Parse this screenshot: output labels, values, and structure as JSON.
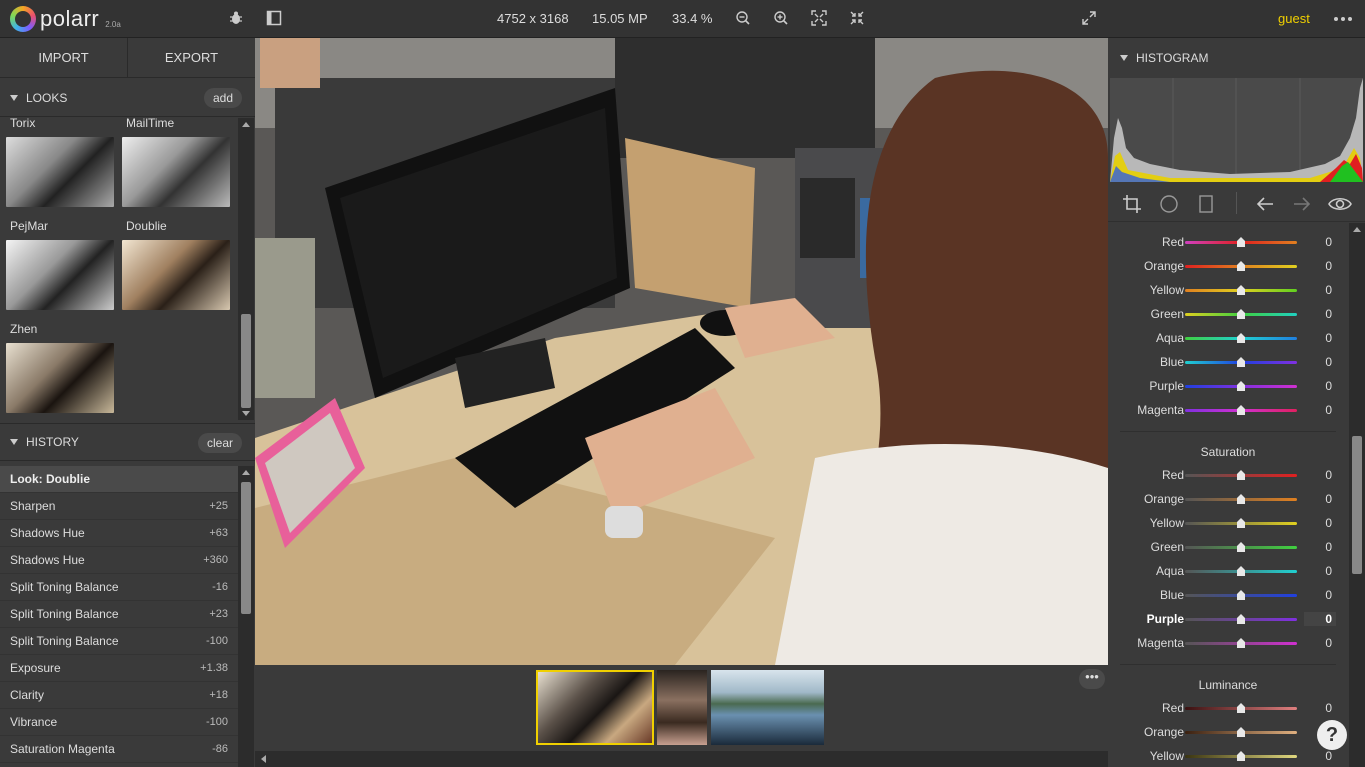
{
  "app": {
    "name": "polarr",
    "version": "2.0a"
  },
  "topbar": {
    "dimensions": "4752 x 3168",
    "megapixels": "15.05 MP",
    "zoom": "33.4 %",
    "user": "guest",
    "icons": [
      "bug-icon",
      "sidebar-toggle-icon",
      "zoom-out-icon",
      "zoom-in-icon",
      "fit-screen-icon",
      "actual-size-icon",
      "fullscreen-icon",
      "more-icon"
    ]
  },
  "left": {
    "import_label": "IMPORT",
    "export_label": "EXPORT",
    "looks": {
      "title": "LOOKS",
      "add_label": "add",
      "items": [
        "Torix",
        "MailTime",
        "PejMar",
        "Doublie",
        "Zhen"
      ]
    },
    "history": {
      "title": "HISTORY",
      "clear_label": "clear",
      "items": [
        {
          "label": "Look: Doublie",
          "value": ""
        },
        {
          "label": "Sharpen",
          "value": "+25"
        },
        {
          "label": "Shadows Hue",
          "value": "+63"
        },
        {
          "label": "Shadows Hue",
          "value": "+360"
        },
        {
          "label": "Split Toning Balance",
          "value": "-16"
        },
        {
          "label": "Split Toning Balance",
          "value": "+23"
        },
        {
          "label": "Split Toning Balance",
          "value": "-100"
        },
        {
          "label": "Exposure",
          "value": "+1.38"
        },
        {
          "label": "Clarity",
          "value": "+18"
        },
        {
          "label": "Vibrance",
          "value": "-100"
        },
        {
          "label": "Saturation Magenta",
          "value": "-86"
        }
      ]
    }
  },
  "filmstrip": {
    "more_label": "•••"
  },
  "right": {
    "histogram_title": "HISTOGRAM",
    "hue": [
      {
        "label": "Red",
        "value": "0"
      },
      {
        "label": "Orange",
        "value": "0"
      },
      {
        "label": "Yellow",
        "value": "0"
      },
      {
        "label": "Green",
        "value": "0"
      },
      {
        "label": "Aqua",
        "value": "0"
      },
      {
        "label": "Blue",
        "value": "0"
      },
      {
        "label": "Purple",
        "value": "0"
      },
      {
        "label": "Magenta",
        "value": "0"
      }
    ],
    "saturation_title": "Saturation",
    "saturation": [
      {
        "label": "Red",
        "value": "0"
      },
      {
        "label": "Orange",
        "value": "0"
      },
      {
        "label": "Yellow",
        "value": "0"
      },
      {
        "label": "Green",
        "value": "0"
      },
      {
        "label": "Aqua",
        "value": "0"
      },
      {
        "label": "Blue",
        "value": "0"
      },
      {
        "label": "Purple",
        "value": "0"
      },
      {
        "label": "Magenta",
        "value": "0"
      }
    ],
    "luminance_title": "Luminance",
    "luminance": [
      {
        "label": "Red",
        "value": "0"
      },
      {
        "label": "Orange",
        "value": "0"
      },
      {
        "label": "Yellow",
        "value": "0"
      }
    ],
    "help_label": "?"
  },
  "colors": {
    "accent": "#f0d000",
    "panel": "#3a3a3a",
    "topbar": "#333333"
  }
}
